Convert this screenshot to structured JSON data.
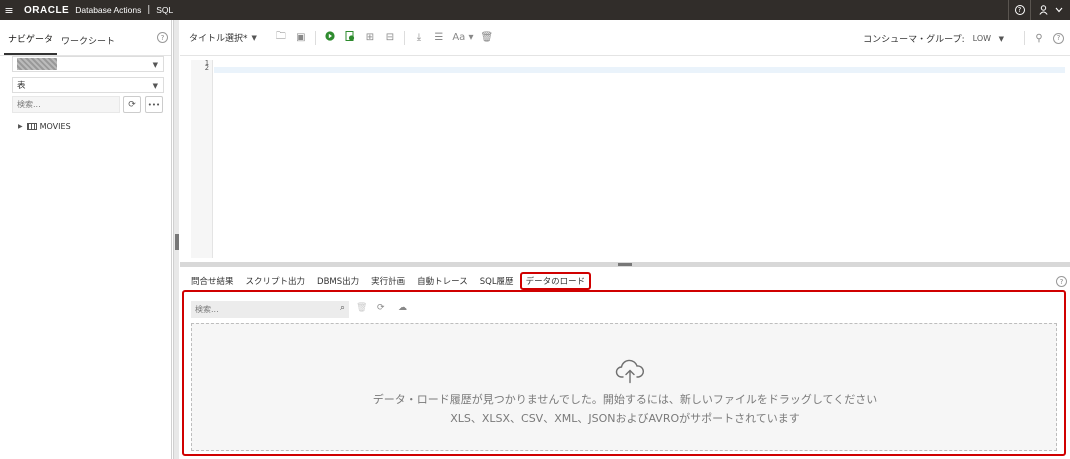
{
  "topbar": {
    "brand": "ORACLE",
    "app": "Database Actions",
    "separator": "|",
    "section": "SQL"
  },
  "navigator": {
    "tabs": [
      "ナビゲータ",
      "ワークシート"
    ],
    "object_type": "表",
    "search_placeholder": "検索...",
    "more_label": "•••",
    "tree": [
      {
        "label": "MOVIES"
      }
    ]
  },
  "toolbar": {
    "title_select": "タイトル選択*",
    "consumer_group_label": "コンシューマ・グループ:",
    "consumer_group_value": "LOW"
  },
  "editor": {
    "line_numbers": [
      "1",
      "2"
    ]
  },
  "results": {
    "tabs": [
      "問合せ結果",
      "スクリプト出力",
      "DBMS出力",
      "実行計画",
      "自動トレース",
      "SQL履歴",
      "データのロード"
    ],
    "active_tab": "データのロード"
  },
  "data_load": {
    "search_placeholder": "検索...",
    "empty_message_1": "データ・ロード履歴が見つかりませんでした。開始するには、新しいファイルをドラッグしてください",
    "empty_message_2": "XLS、XLSX、CSV、XML、JSONおよびAVROがサポートされています"
  },
  "colors": {
    "topbar_bg": "#312d2a",
    "highlight_border": "#d00000",
    "run_green": "#2e8b2e"
  }
}
